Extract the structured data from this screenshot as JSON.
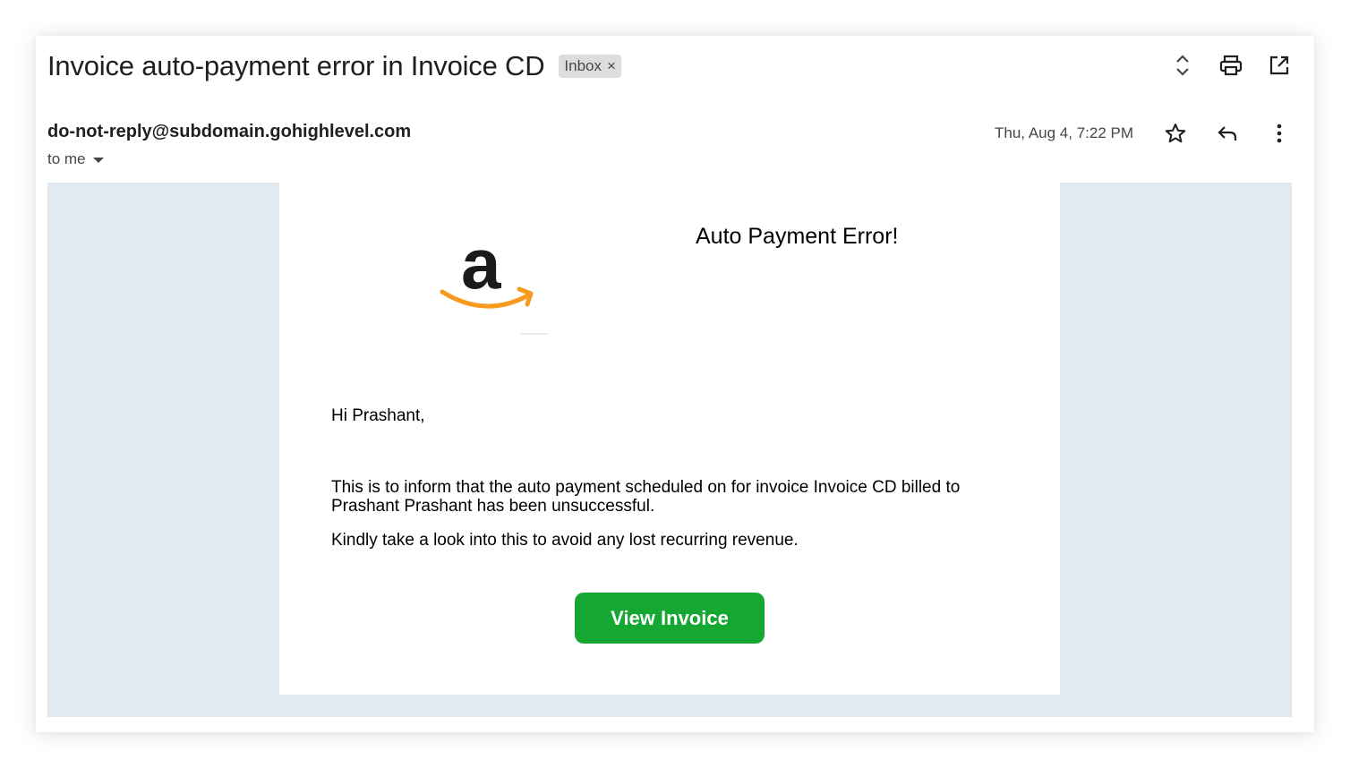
{
  "subject": "Invoice auto-payment error in Invoice CD",
  "label": {
    "text": "Inbox",
    "remove": "×"
  },
  "top_actions": [
    "expand-collapse-icon",
    "print-icon",
    "open-in-new-window-icon"
  ],
  "sender": {
    "email": "do-not-reply@subdomain.gohighlevel.com",
    "recipient": "to me"
  },
  "date": "Thu, Aug 4, 7:22 PM",
  "meta_actions": [
    "star-icon",
    "reply-icon",
    "more-vert-icon"
  ],
  "email": {
    "headline": "Auto Payment Error!",
    "greeting": "Hi Prashant,",
    "paragraph1": "This is to inform that the auto payment scheduled on for invoice Invoice CD billed to Prashant Prashant has been unsuccessful.",
    "paragraph2": "Kindly take a look into this to avoid any lost recurring revenue.",
    "button": "View Invoice",
    "logo": "amazon-logo"
  },
  "colors": {
    "button": "#16a733",
    "email_background": "#e3e9f1",
    "logo_arrow": "#f79a1d",
    "logo_letter": "#1a1a1a"
  }
}
